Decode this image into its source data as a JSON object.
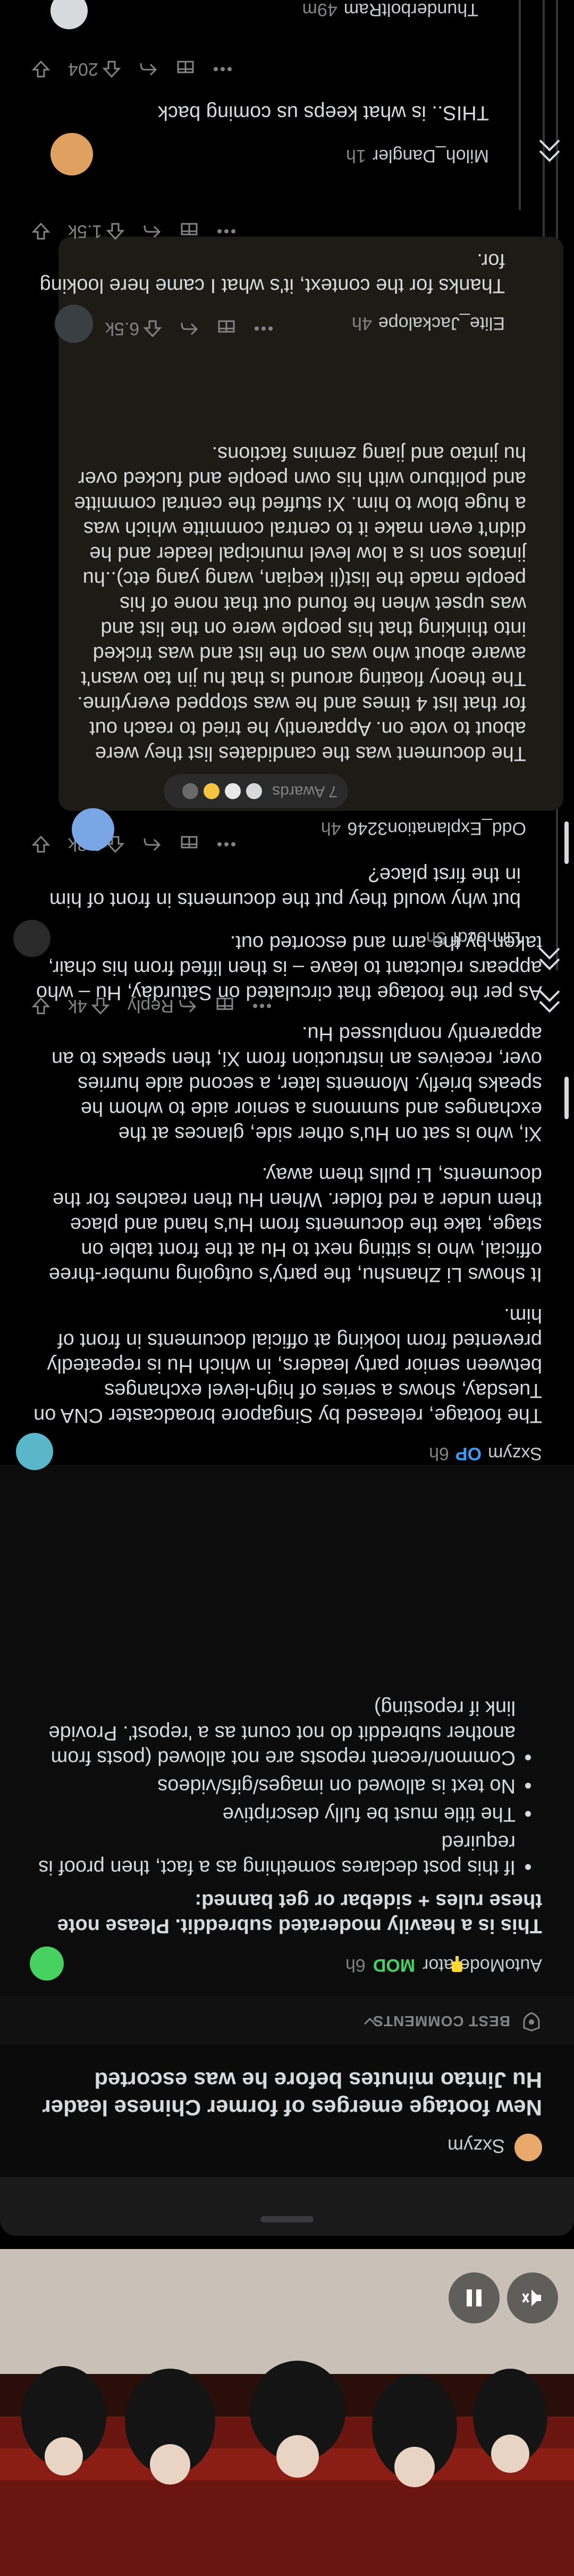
{
  "post": {
    "author": "Sxzym",
    "title": "New footage emerges of former Chinese leader Hu Jintao minutes before he was escorted"
  },
  "sort": {
    "label": "BEST COMMENTS"
  },
  "pinned": {
    "author": "AutoModerator",
    "mod_badge": "MOD",
    "time": "6h",
    "heading": "This is a heavily moderated subreddit. Please note these rules + sidebar or get banned:",
    "rules": [
      "If this post declares something as a fact, then proof is required",
      "The title must be fully descriptive",
      "No text is allowed on images/gifs/videos",
      "Common/recent reposts are not allowed (posts from another subreddit do not count as a 'repost'. Provide link if reposting)"
    ]
  },
  "comments": [
    {
      "author": "Sxzym",
      "op": "OP",
      "time": "6h",
      "paragraphs": [
        "The footage, released by Singapore broadcaster CNA on Tuesday, shows a series of high-level exchanges between senior party leaders, in which Hu is repeatedly prevented from looking at official documents in front of him.",
        "It shows Li Zhanshu, the party's outgoing number-three official, who is sitting next to Hu at the front table on stage, take the documents from Hu's hand and place them under a red folder. When Hu then reaches for the documents, Li pulls them away.",
        "Xi, who is sat on Hu's other side, glances at the exchanges and summons a senior aide to whom he speaks briefly. Moments later, a second aide hurries over, receives an instruction from Xi, then speaks to an apparently nonplussed Hu.",
        "As per the footage that circulated on Saturday, Hu – who appears reluctant to leave – is then lifted from his chair, taken by the arm and escorted out."
      ],
      "reply": "Reply",
      "score": "4k"
    },
    {
      "author": "Linhocdf",
      "time": "5h",
      "text": "but why would they put the documents in front of him in the first place?",
      "score": "2.3k"
    },
    {
      "author": "Odd_Explanation3246",
      "time": "4h",
      "awards": "7 Awards",
      "text": "The document was the candidates list they were about to vote on. Apparently he tried to reach out for that list 4 times and he was stopped everytime. The theory floating around is that hu jin tao wasn't aware about who was on the list and was tricked into thinking that his people were on the list and was upset when he found out that none of his people made the list(li keqian, wang yang etc)..hu jintaos son is a low level municipal leader and he didn't even make it to central committe which was a huge blow to him. Xi stuffed the central committe and politburo with his own people and fucked over hu jintao and jiang zemins factions.",
      "score": "6.5k"
    },
    {
      "author": "Elite_Jackalope",
      "time": "4h",
      "text": "Thanks for the context, it's what I came here looking for.",
      "score": "1.5k"
    },
    {
      "author": "Miloh_Dangler",
      "time": "1h",
      "text": "THIS.. is what keeps us coming back",
      "score": "204"
    },
    {
      "author": "ThunderboltRam",
      "time": "49m"
    }
  ],
  "icons": [
    "play-pause-icon",
    "mute-icon",
    "shield-icon",
    "chevron-down-icon",
    "upvote-icon",
    "downvote-icon",
    "reply-icon",
    "award-icon",
    "more-icon",
    "collapse-icon"
  ],
  "colors": {
    "accent": "#ff4500",
    "mod": "#46d160",
    "op": "#3d9bf9",
    "bg": "#000000"
  }
}
